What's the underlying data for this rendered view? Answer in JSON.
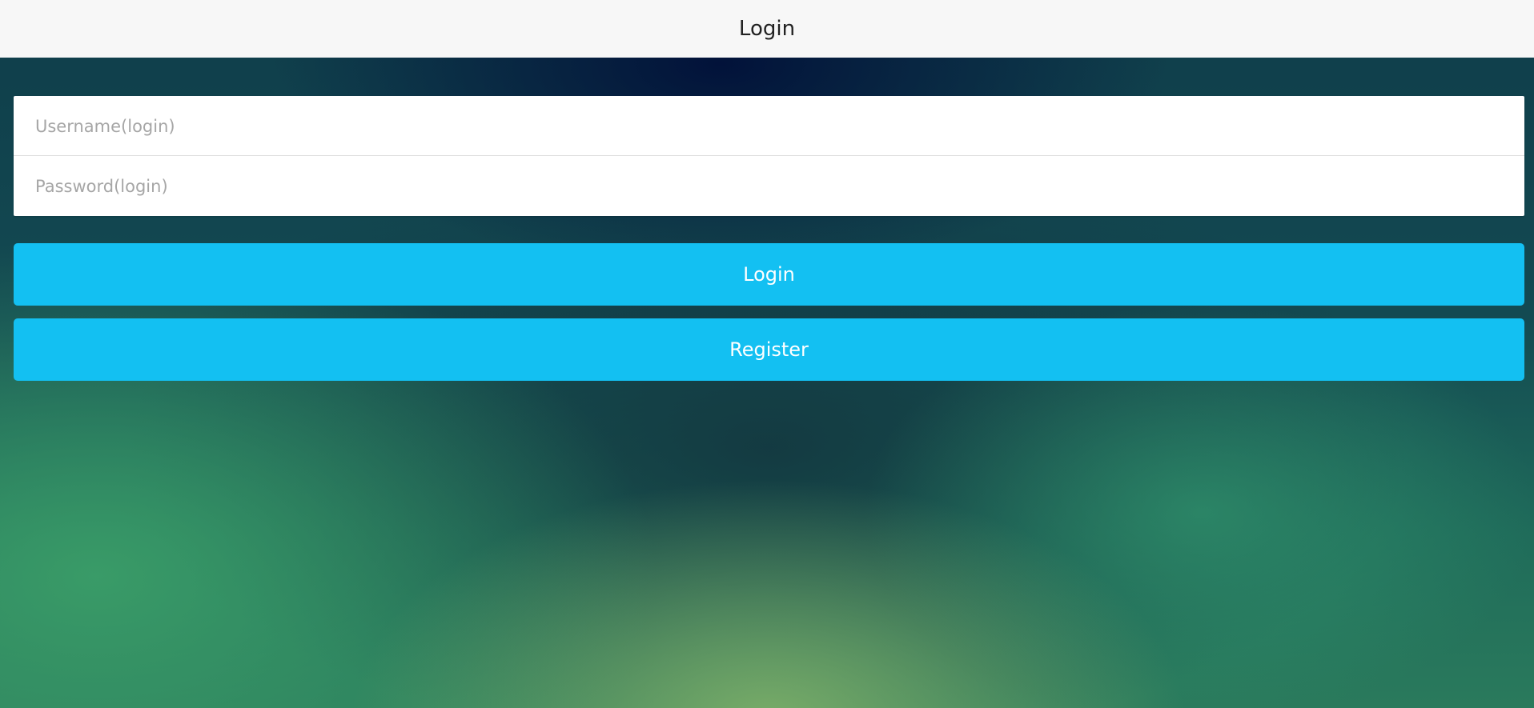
{
  "header": {
    "title": "Login"
  },
  "form": {
    "username_placeholder": "Username(login)",
    "password_placeholder": "Password(login)",
    "username_value": "",
    "password_value": ""
  },
  "actions": {
    "login_label": "Login",
    "register_label": "Register"
  },
  "colors": {
    "header_bg": "#f7f7f7",
    "button_bg": "#13c0f2",
    "button_text": "#ffffff"
  }
}
